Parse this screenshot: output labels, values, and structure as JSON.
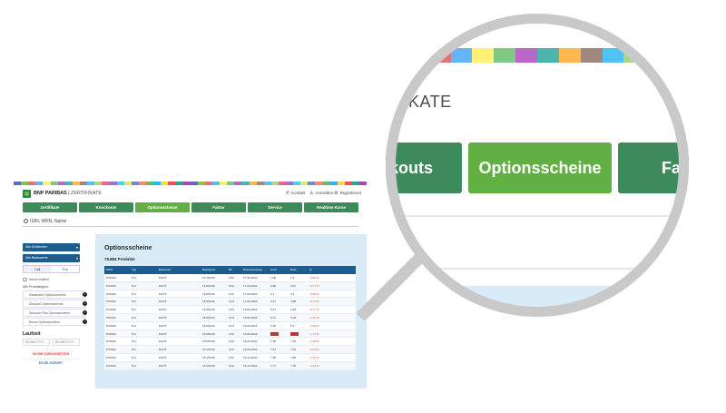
{
  "stripe_colors": [
    "#5b6abf",
    "#8bc34a",
    "#e57373",
    "#64b5f6",
    "#fff176",
    "#81c784",
    "#ba68c8",
    "#4db6ac",
    "#ffb74d",
    "#a1887f",
    "#4fc3f7",
    "#aed581",
    "#f06292",
    "#9575cd",
    "#4dd0e1",
    "#dce775",
    "#7986cb",
    "#ff8a65",
    "#66bb6a",
    "#29b6f6",
    "#ffd54f",
    "#ef5350",
    "#26a69a",
    "#ab47bc"
  ],
  "colors": {
    "nav_green": "#3d8a5b",
    "nav_active": "#62b043",
    "table_header": "#1e5c8c",
    "panel_bg": "#d8ebf7",
    "negative": "#d8452e"
  },
  "header": {
    "brand": "BNP PARIBAS",
    "brand_sub": "| ZERTIFIKATE",
    "kontakt": "Kontakt",
    "anmelden": "Anmelden",
    "registrieren": "Registrieren"
  },
  "nav": [
    "Zertifikate",
    "Knockouts",
    "Optionsscheine",
    "Faktor",
    "Service",
    "Realtime Kurse"
  ],
  "search": {
    "placeholder": "ISIN, WKN, Name"
  },
  "sidebar": {
    "select1": "Alle Emittenten",
    "select2": "Alle Basiswerte",
    "seg": [
      "Call",
      "Put"
    ],
    "heute_emittiert": "Heute emittiert",
    "produkttypen_label": "Alle Produkttypen",
    "produkttypen": [
      "Klassische Optionsscheine",
      "Discount Optionsscheine",
      "Discount Plus Optionsscheine",
      "Bonus Optionsscheine"
    ],
    "laufzeit": "Laufzeit",
    "date_from": "DD.MM.YYYY",
    "date_to": "DD.MM.YYYY",
    "reset": "SUCHE ZURÜCKSETZEN",
    "export": "EXCEL EXPORT"
  },
  "main": {
    "title": "Optionsscheine",
    "count": "79.884 Produkte",
    "columns": [
      "WKN",
      "Typ",
      "Basiswert",
      "Basispreis",
      "BV",
      "Bewertungstag",
      "Geld",
      "Brief",
      "%"
    ],
    "rows": [
      [
        "PX0021",
        "Put",
        "DAX®",
        "16.750,00",
        "0,01",
        "17.06.2022",
        "1,08",
        "1,9",
        "-0,82 %"
      ],
      [
        "PX0021",
        "Put",
        "DAX®",
        "16.800,00",
        "0,01",
        "17.06.2022",
        "0,98",
        "0,97",
        "-0,77 %"
      ],
      [
        "PX0021",
        "Put",
        "DAX®",
        "16.850,00",
        "0,01",
        "17.06.2022",
        "3,1",
        "3,1",
        "-0,68 %"
      ],
      [
        "PX0021",
        "Put",
        "DAX®",
        "16.900,00",
        "0,01",
        "17.06.2022",
        "3,27",
        "3,08",
        "-0,72 %"
      ],
      [
        "PX0021",
        "Put",
        "DAX®",
        "16.950,00",
        "0,01",
        "16.09.2022",
        "5,27",
        "5,28",
        "-0,77 %"
      ],
      [
        "PX0021",
        "Put",
        "DAX®",
        "15.000,00",
        "0,01",
        "16.09.2022",
        "5,31",
        "5,32",
        "-1,07 %"
      ],
      [
        "PX0021",
        "Put",
        "DAX®",
        "15.050,00",
        "0,01",
        "16.09.2022",
        "5,36",
        "5,4",
        "-1,06 %"
      ],
      [
        "PX0021",
        "Put",
        "DAX®",
        "15.050,00",
        "0,01",
        "16.09.2022",
        "",
        "",
        "-1,77 %"
      ],
      [
        "PX0021",
        "Put",
        "DAX®",
        "15.050,00",
        "0,01",
        "16.09.2022",
        "7,35",
        "7,36",
        "-1,08 %"
      ],
      [
        "PX0021",
        "Put",
        "DAX®",
        "15.100,00",
        "0,01",
        "16.09.2022",
        "7,51",
        "7,53",
        "-1,07 %"
      ],
      [
        "PX0021",
        "Put",
        "DAX®",
        "15.150,00",
        "0,01",
        "16.12.2022",
        "7,65",
        "7,66",
        "-1,11 %"
      ],
      [
        "PX0021",
        "Put",
        "DAX®",
        "15.150,00",
        "0,01",
        "16.12.2022",
        "7,77",
        "7,78",
        "-1,13 %"
      ]
    ]
  },
  "lens": {
    "heading": "FIKATE",
    "btn_left": "kouts",
    "btn_center": "Optionsscheine",
    "btn_right": "Fak"
  }
}
